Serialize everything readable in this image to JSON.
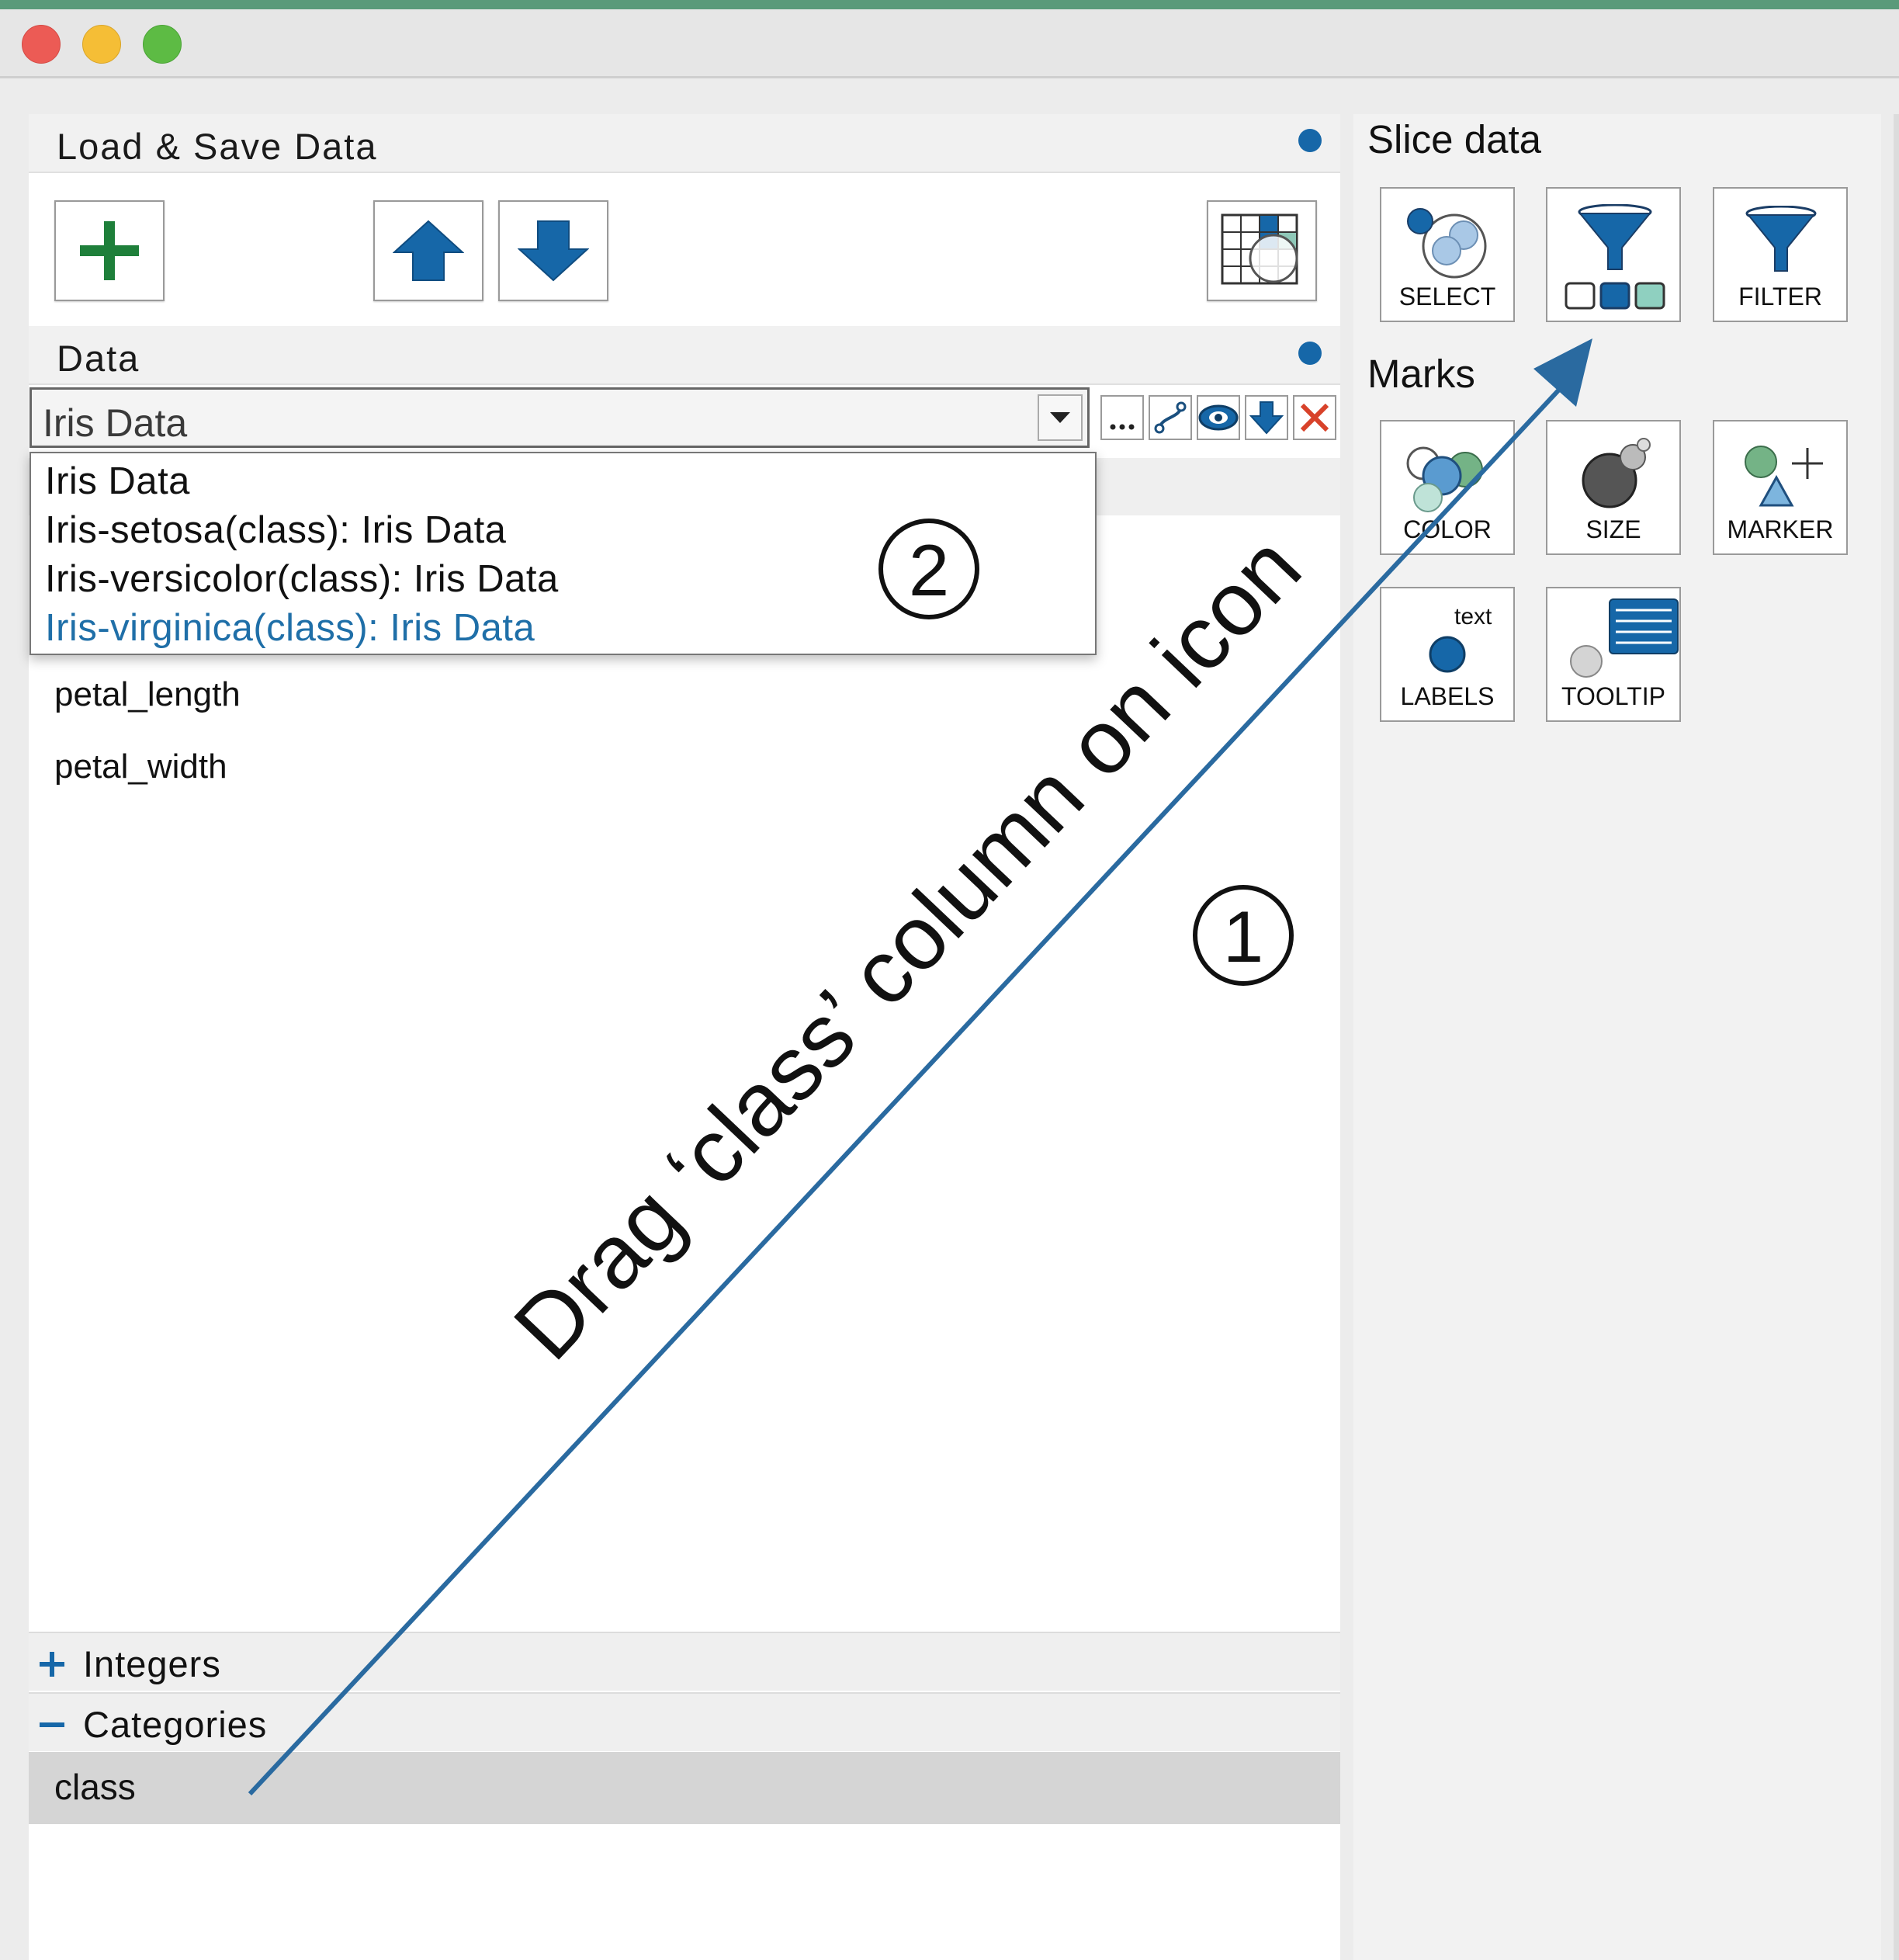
{
  "load_save": {
    "title": "Load  &  Save  Data"
  },
  "data_section": {
    "title": "Data",
    "combo_value": "Iris Data",
    "dropdown_options": [
      "Iris Data",
      "Iris-setosa(class): Iris Data",
      "Iris-versicolor(class): Iris Data",
      "Iris-virginica(class): Iris Data"
    ],
    "selected_option_color": "#1f6fa8",
    "fields": [
      "petal_length",
      "petal_width"
    ],
    "groups": {
      "integers": "Integers",
      "categories": "Categories"
    },
    "category_items": [
      "class"
    ]
  },
  "slice_data": {
    "title": "Slice data",
    "tiles": {
      "select": "SELECT",
      "filter": "FILTER"
    }
  },
  "marks": {
    "title": "Marks",
    "tiles": {
      "color": "COLOR",
      "size": "SIZE",
      "marker": "MARKER",
      "labels": "LABELS",
      "labels_text": "text",
      "tooltip": "TOOLTIP"
    }
  },
  "annotation": {
    "instruction": "Drag ‘class’ column on icon",
    "step1": "1",
    "step2": "2",
    "arrow_color": "#2a6aa0"
  },
  "colors": {
    "accent": "#1667a8",
    "add_green": "#1e7f3a",
    "delete_red": "#d8422a"
  }
}
